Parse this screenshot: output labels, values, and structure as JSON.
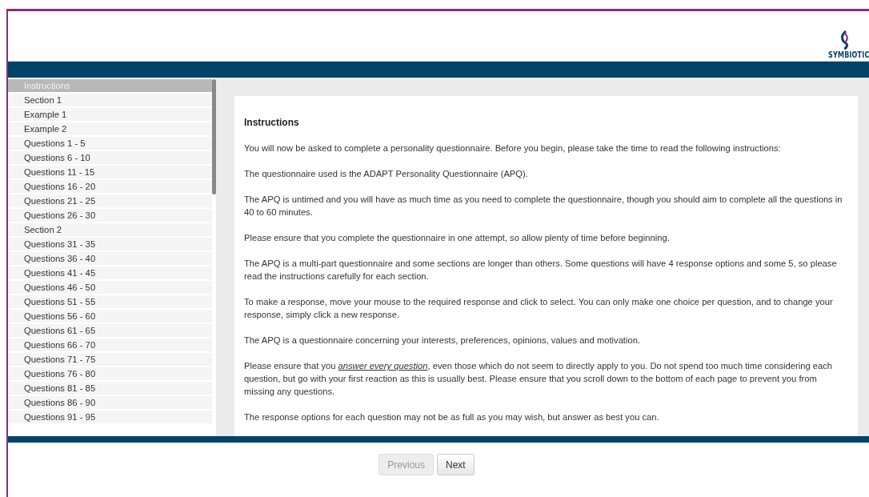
{
  "header": {
    "logo_text": "SYMBIOTIC"
  },
  "sidebar": {
    "items": [
      {
        "label": "Instructions",
        "selected": true
      },
      {
        "label": "Section 1",
        "selected": false
      },
      {
        "label": "Example 1",
        "selected": false
      },
      {
        "label": "Example 2",
        "selected": false
      },
      {
        "label": "Questions 1 - 5",
        "selected": false
      },
      {
        "label": "Questions 6 - 10",
        "selected": false
      },
      {
        "label": "Questions 11 - 15",
        "selected": false
      },
      {
        "label": "Questions 16 - 20",
        "selected": false
      },
      {
        "label": "Questions 21 - 25",
        "selected": false
      },
      {
        "label": "Questions 26 - 30",
        "selected": false
      },
      {
        "label": "Section 2",
        "selected": false
      },
      {
        "label": "Questions 31 - 35",
        "selected": false
      },
      {
        "label": "Questions 36 - 40",
        "selected": false
      },
      {
        "label": "Questions 41 - 45",
        "selected": false
      },
      {
        "label": "Questions 46 - 50",
        "selected": false
      },
      {
        "label": "Questions 51 - 55",
        "selected": false
      },
      {
        "label": "Questions 56 - 60",
        "selected": false
      },
      {
        "label": "Questions 61 - 65",
        "selected": false
      },
      {
        "label": "Questions 66 - 70",
        "selected": false
      },
      {
        "label": "Questions 71 - 75",
        "selected": false
      },
      {
        "label": "Questions 76 - 80",
        "selected": false
      },
      {
        "label": "Questions 81 - 85",
        "selected": false
      },
      {
        "label": "Questions 86 - 90",
        "selected": false
      },
      {
        "label": "Questions 91 - 95",
        "selected": false
      }
    ]
  },
  "content": {
    "title": "Instructions",
    "paragraphs": [
      "You will now be asked to complete a personality questionnaire. Before you begin, please take the time to read the following instructions:",
      "The questionnaire used is the ADAPT Personality Questionnaire (APQ).",
      "The APQ is untimed and you will have as much time as you need to complete the questionnaire, though you should aim to complete all the questions in 40 to 60 minutes.",
      "Please ensure that you complete the questionnaire in one attempt, so allow plenty of time before beginning.",
      "The APQ is a multi-part questionnaire and some sections are longer than others. Some questions will have 4 response options and some 5, so please read the instructions carefully for each section.",
      "To make a response, move your mouse to the required response and click to select. You can only make one choice per question, and to change your response, simply click a new response.",
      "The APQ is a questionnaire concerning your interests, preferences, opinions, values and motivation.",
      "Please ensure that you *answer every question*, even those which do not seem to directly apply to you. Do not spend too much time considering each question, but go with your first reaction as this is usually best. Please ensure that you scroll down to the bottom of each page to prevent you from missing any questions.",
      "The response options for each question may not be as full as you may wish, but answer as best you can."
    ]
  },
  "buttons": [
    {
      "label": "Previous",
      "disabled": true
    },
    {
      "label": "Next",
      "disabled": false
    }
  ]
}
